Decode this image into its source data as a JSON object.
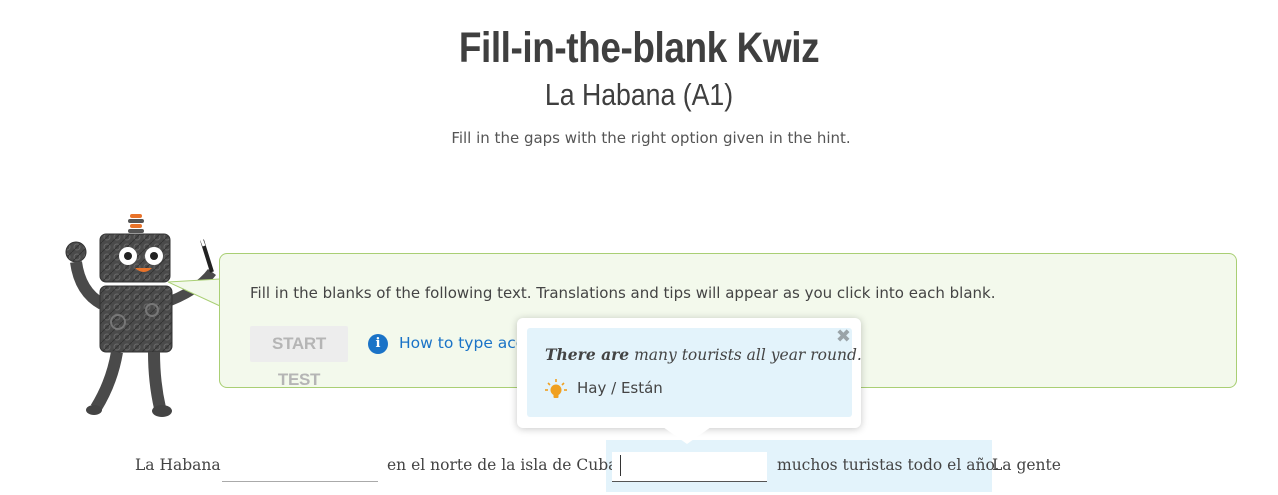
{
  "header": {
    "title": "Fill-in-the-blank Kwiz",
    "subtitle": "La Habana (A1)",
    "instructions": "Fill in the gaps with the right option given in the hint."
  },
  "panel": {
    "intro": "Fill in the blanks of the following text. Translations and tips will appear as you click into each blank.",
    "start_label": "START TEST",
    "accents_link": "How to type acce"
  },
  "tooltip": {
    "translation_bold": "There are",
    "translation_rest": " many tourists all year round.",
    "close_symbol": "✖",
    "hint": "Hay / Están",
    "icon": "lightbulb-icon"
  },
  "exercise": {
    "seg1": "La Habana",
    "seg2": "en el norte de la isla de Cuba.",
    "seg3": "muchos turistas todo el año.",
    "seg4": "La gente",
    "blank1_value": "",
    "blank2_value": ""
  },
  "colors": {
    "panel_bg": "#f3f9ec",
    "panel_border": "#a9cf74",
    "link": "#1a73c7",
    "tooltip_bg": "#e3f3fb",
    "hint_bulb": "#f0a020"
  }
}
